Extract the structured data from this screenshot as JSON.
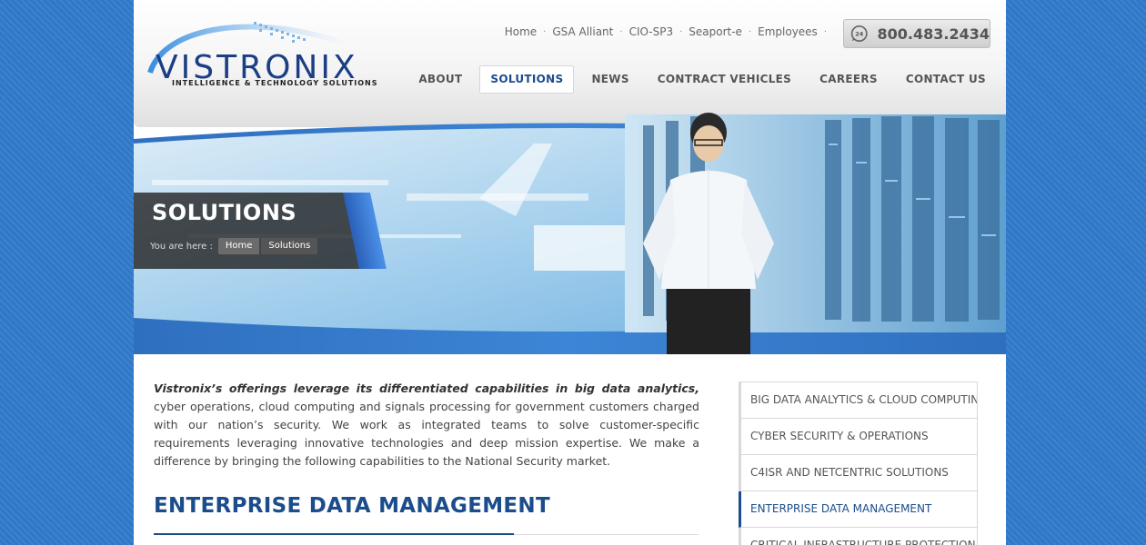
{
  "brand": {
    "name": "VISTRONIX",
    "tagline": "INTELLIGENCE & TECHNOLOGY SOLUTIONS"
  },
  "toplinks": [
    "Home",
    "GSA Alliant",
    "CIO-SP3",
    "Seaport-e",
    "Employees"
  ],
  "phone": {
    "badge": "24",
    "number": "800.483.2434"
  },
  "nav": {
    "items": [
      "ABOUT",
      "SOLUTIONS",
      "NEWS",
      "CONTRACT VEHICLES",
      "CAREERS",
      "CONTACT US"
    ],
    "active": "SOLUTIONS"
  },
  "hero": {
    "title": "SOLUTIONS",
    "breadcrumb_label": "You are here :",
    "breadcrumbs": [
      "Home",
      "Solutions"
    ]
  },
  "intro": {
    "lead": "Vistronix’s offerings leverage its differentiated capabilities in big data analytics,",
    "body": " cyber operations, cloud computing and signals processing for government customers charged with our nation’s security.  We work as integrated teams to solve customer-specific requirements leveraging innovative technologies and deep mission expertise.  We make a difference by bringing the following capabilities to the National Security market."
  },
  "section": {
    "title": "ENTERPRISE DATA MANAGEMENT"
  },
  "sidebar": {
    "items": [
      "BIG DATA ANALYTICS & CLOUD COMPUTING",
      "CYBER SECURITY & OPERATIONS",
      "C4ISR AND NETCENTRIC SOLUTIONS",
      "ENTERPRISE DATA MANAGEMENT",
      "CRITICAL INFRASTRUCTURE PROTECTION"
    ],
    "active": "ENTERPRISE DATA MANAGEMENT"
  },
  "colors": {
    "brand_blue": "#1b4d8c",
    "background_blue": "#2f78c8",
    "banner_blue": "#2a6fc4"
  }
}
